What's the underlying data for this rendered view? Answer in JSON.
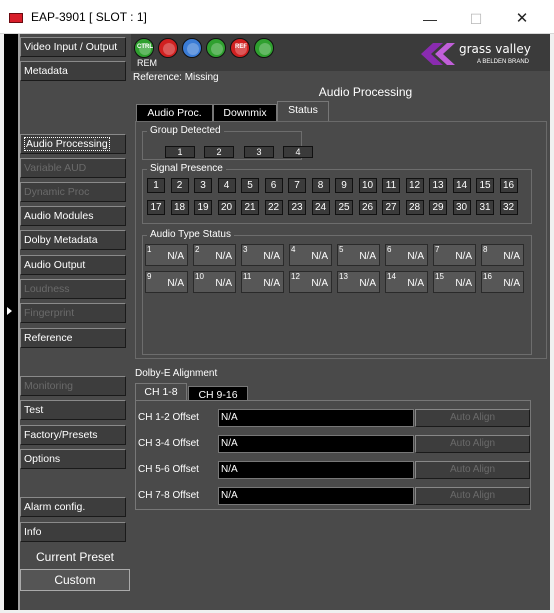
{
  "window": {
    "title": "EAP-3901 [ SLOT : 1]",
    "min_glyph": "—",
    "max_glyph": "☐",
    "close_glyph": "✕"
  },
  "toolbar": {
    "icons": [
      {
        "label": "CTRL",
        "color": "#2fa02f"
      },
      {
        "label": "",
        "color": "#d02020"
      },
      {
        "label": "",
        "color": "#3a7bd5"
      },
      {
        "label": "",
        "color": "#2fa02f"
      },
      {
        "label": "REF",
        "color": "#d02020"
      },
      {
        "label": "",
        "color": "#2fa02f"
      }
    ],
    "rem_label": "REM",
    "logo_line1": "grass valley",
    "logo_line2": "A BELDEN BRAND"
  },
  "reference": "Reference: Missing",
  "page_title": "Audio Processing",
  "nav": {
    "items": [
      {
        "label": "Video Input / Output",
        "state": "normal"
      },
      {
        "label": "Metadata",
        "state": "normal"
      },
      {
        "label": "Audio Processing",
        "state": "selected"
      },
      {
        "label": "Variable AUD",
        "state": "disabled"
      },
      {
        "label": "Dynamic Proc",
        "state": "disabled"
      },
      {
        "label": "Audio Modules",
        "state": "normal"
      },
      {
        "label": "Dolby Metadata",
        "state": "normal"
      },
      {
        "label": "Audio Output",
        "state": "normal"
      },
      {
        "label": "Loudness",
        "state": "disabled"
      },
      {
        "label": "Fingerprint",
        "state": "disabled"
      },
      {
        "label": "Reference",
        "state": "normal"
      },
      {
        "label": "Monitoring",
        "state": "disabled"
      },
      {
        "label": "Test",
        "state": "normal"
      },
      {
        "label": "Factory/Presets",
        "state": "normal"
      },
      {
        "label": "Options",
        "state": "normal"
      },
      {
        "label": "Alarm config.",
        "state": "normal"
      },
      {
        "label": "Info",
        "state": "normal"
      }
    ],
    "current_preset_label": "Current Preset",
    "current_preset_value": "Custom"
  },
  "tabs": [
    {
      "label": "Audio Proc.",
      "active": false
    },
    {
      "label": "Downmix",
      "active": false
    },
    {
      "label": "Status",
      "active": true
    }
  ],
  "group_detected": {
    "title": "Group Detected",
    "values": [
      "1",
      "2",
      "3",
      "4"
    ]
  },
  "signal_presence": {
    "title": "Signal Presence",
    "channels": [
      "1",
      "2",
      "3",
      "4",
      "5",
      "6",
      "7",
      "8",
      "9",
      "10",
      "11",
      "12",
      "13",
      "14",
      "15",
      "16",
      "17",
      "18",
      "19",
      "20",
      "21",
      "22",
      "23",
      "24",
      "25",
      "26",
      "27",
      "28",
      "29",
      "30",
      "31",
      "32"
    ]
  },
  "audio_type_status": {
    "title": "Audio Type Status",
    "cells": [
      {
        "num": "1",
        "value": "N/A"
      },
      {
        "num": "2",
        "value": "N/A"
      },
      {
        "num": "3",
        "value": "N/A"
      },
      {
        "num": "4",
        "value": "N/A"
      },
      {
        "num": "5",
        "value": "N/A"
      },
      {
        "num": "6",
        "value": "N/A"
      },
      {
        "num": "7",
        "value": "N/A"
      },
      {
        "num": "8",
        "value": "N/A"
      },
      {
        "num": "9",
        "value": "N/A"
      },
      {
        "num": "10",
        "value": "N/A"
      },
      {
        "num": "11",
        "value": "N/A"
      },
      {
        "num": "12",
        "value": "N/A"
      },
      {
        "num": "13",
        "value": "N/A"
      },
      {
        "num": "14",
        "value": "N/A"
      },
      {
        "num": "15",
        "value": "N/A"
      },
      {
        "num": "16",
        "value": "N/A"
      }
    ]
  },
  "dolby_e": {
    "title": "Dolby-E Alignment",
    "tabs": [
      {
        "label": "CH 1-8",
        "active": true
      },
      {
        "label": "CH 9-16",
        "active": false
      }
    ],
    "offsets": [
      {
        "label": "CH 1-2 Offset",
        "value": "N/A",
        "button": "Auto Align"
      },
      {
        "label": "CH 3-4 Offset",
        "value": "N/A",
        "button": "Auto Align"
      },
      {
        "label": "CH 5-6 Offset",
        "value": "N/A",
        "button": "Auto Align"
      },
      {
        "label": "CH 7-8 Offset",
        "value": "N/A",
        "button": "Auto Align"
      }
    ]
  }
}
